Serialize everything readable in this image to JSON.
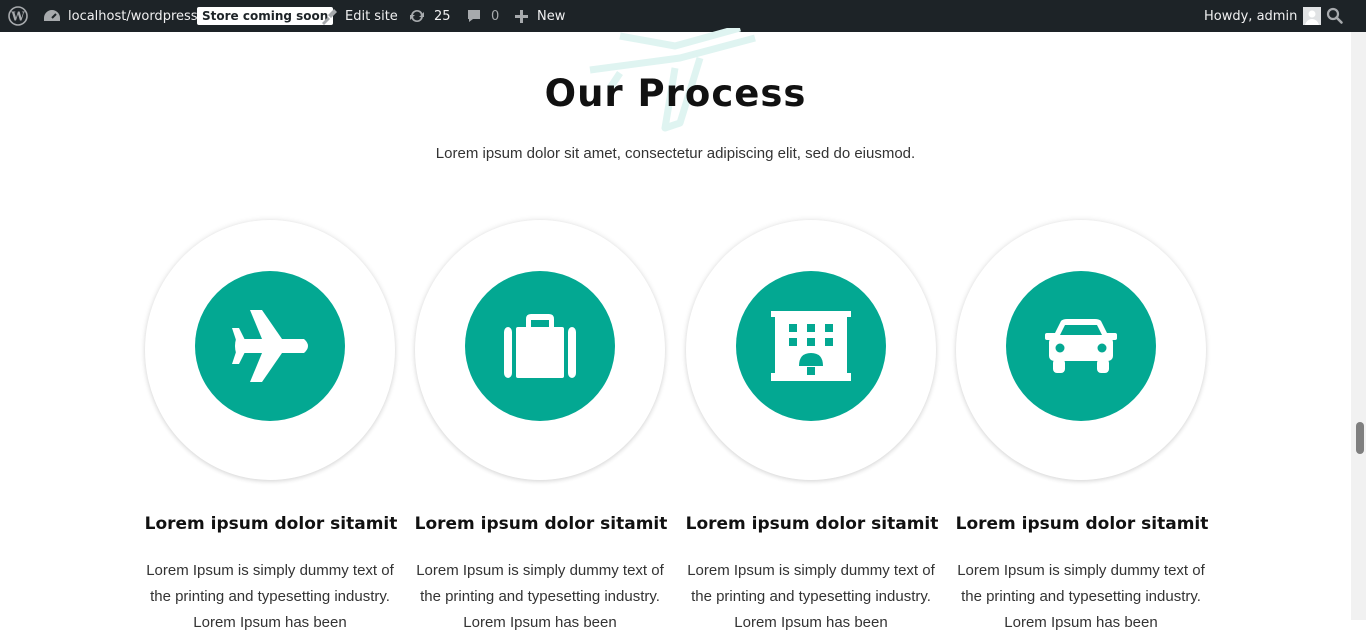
{
  "adminbar": {
    "site_name": "localhost/wordpress",
    "store_badge": "Store coming soon",
    "edit_site": "Edit site",
    "updates_count": "25",
    "comments_count": "0",
    "new_label": "New",
    "howdy": "Howdy, admin"
  },
  "section": {
    "title": "Our Process",
    "subtitle": "Lorem ipsum dolor sit amet, consectetur adipiscing elit, sed do eiusmod."
  },
  "cards": [
    {
      "icon": "airplane-icon",
      "title": "Lorem ipsum dolor sitamit",
      "text": "Lorem Ipsum is simply dummy text of the printing and typesetting industry. Lorem Ipsum has been"
    },
    {
      "icon": "suitcase-icon",
      "title": "Lorem ipsum dolor sitamit",
      "text": "Lorem Ipsum is simply dummy text of the printing and typesetting industry. Lorem Ipsum has been"
    },
    {
      "icon": "hotel-icon",
      "title": "Lorem ipsum dolor sitamit",
      "text": "Lorem Ipsum is simply dummy text of the printing and typesetting industry. Lorem Ipsum has been"
    },
    {
      "icon": "car-icon",
      "title": "Lorem ipsum dolor sitamit",
      "text": "Lorem Ipsum is simply dummy text of the printing and typesetting industry. Lorem Ipsum has been"
    }
  ],
  "colors": {
    "accent": "#03a892",
    "adminbar": "#1d2327"
  }
}
